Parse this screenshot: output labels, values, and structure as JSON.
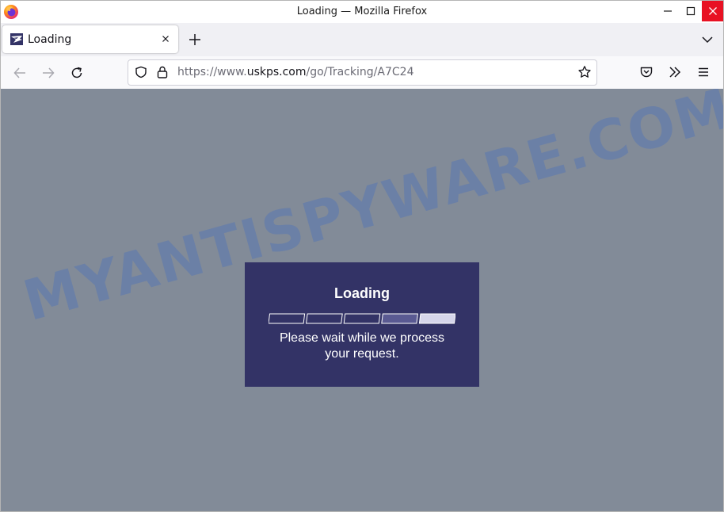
{
  "window": {
    "title": "Loading — Mozilla Firefox"
  },
  "tab": {
    "title": "Loading"
  },
  "url": {
    "prefix": "https://www.",
    "domain": "uskps.com",
    "path": "/go/Tracking/A7C24"
  },
  "page": {
    "watermark": "MYANTISPYWARE.COM",
    "modal": {
      "title": "Loading",
      "message": "Please wait while we process your request.",
      "progress_steps": 5,
      "progress_filled": 2
    }
  },
  "colors": {
    "page_background": "#828b98",
    "modal_background": "#333366",
    "close_button": "#e81123",
    "watermark": "#3d6bc4"
  },
  "icons": {
    "browser_logo": "firefox-logo-icon",
    "tab_favicon": "usps-eagle-icon",
    "back": "arrow-left-icon",
    "forward": "arrow-right-icon",
    "reload": "reload-icon",
    "shield": "shield-icon",
    "lock": "lock-icon",
    "bookmark": "star-icon",
    "pocket": "pocket-icon",
    "extensions": "chevrons-right-icon",
    "menu": "hamburger-menu-icon"
  }
}
